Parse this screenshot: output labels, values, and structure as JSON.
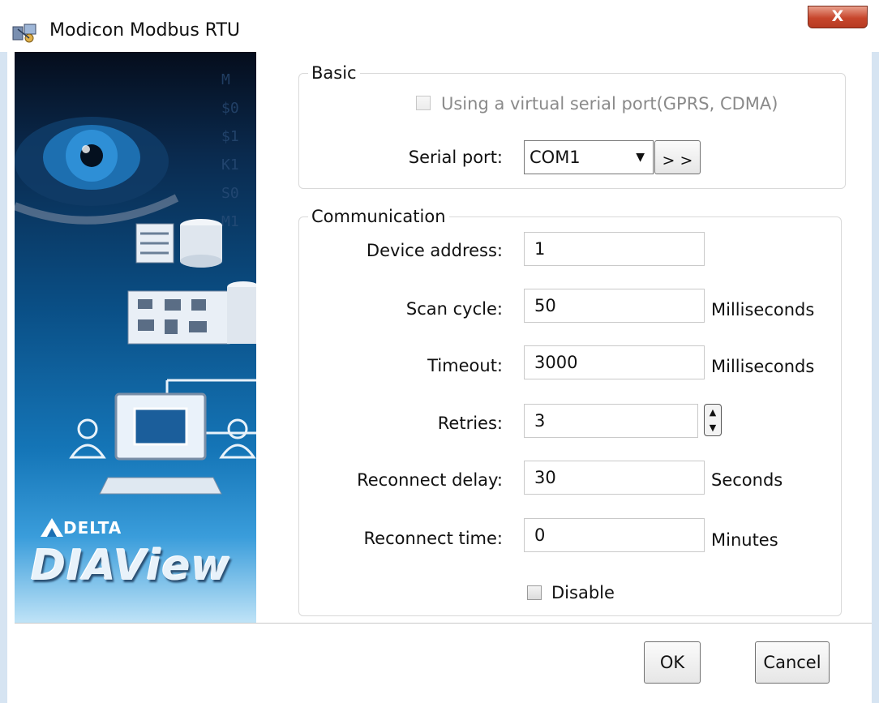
{
  "window": {
    "title": "Modicon Modbus RTU",
    "close_label": "X"
  },
  "banner": {
    "brand_small": "DELTA",
    "brand_large": "DIAView"
  },
  "basic": {
    "title": "Basic",
    "virtual_port_label": "Using a virtual serial port(GPRS, CDMA)",
    "virtual_port_checked": false,
    "virtual_port_enabled": false,
    "serial_port_label": "Serial port:",
    "serial_port_value": "COM1",
    "more_button_label": "> >"
  },
  "communication": {
    "title": "Communication",
    "device_address_label": "Device address:",
    "device_address_value": "1",
    "scan_cycle_label": "Scan cycle:",
    "scan_cycle_value": "50",
    "scan_cycle_unit": "Milliseconds",
    "timeout_label": "Timeout:",
    "timeout_value": "3000",
    "timeout_unit": "Milliseconds",
    "retries_label": "Retries:",
    "retries_value": "3",
    "reconnect_delay_label": "Reconnect delay:",
    "reconnect_delay_value": "30",
    "reconnect_delay_unit": "Seconds",
    "reconnect_time_label": "Reconnect time:",
    "reconnect_time_value": "0",
    "reconnect_time_unit": "Minutes",
    "disable_label": "Disable",
    "disable_checked": false
  },
  "footer": {
    "ok_label": "OK",
    "cancel_label": "Cancel"
  },
  "colors": {
    "close_button": "#c7462c",
    "banner_dark": "#0a2a4e",
    "banner_light": "#3a9ddb"
  }
}
